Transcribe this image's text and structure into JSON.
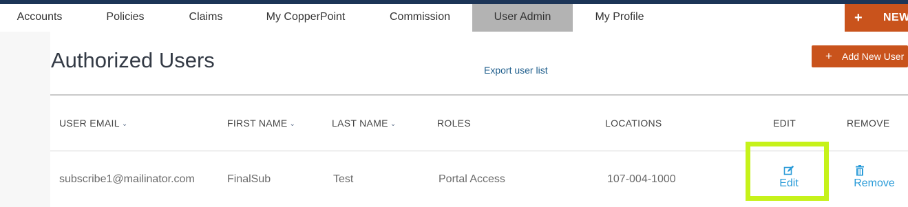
{
  "nav": {
    "items": [
      {
        "label": "Accounts"
      },
      {
        "label": "Policies"
      },
      {
        "label": "Claims"
      },
      {
        "label": "My CopperPoint"
      },
      {
        "label": "Commission"
      },
      {
        "label": "User Admin",
        "active": true
      },
      {
        "label": "My Profile"
      }
    ],
    "new_button": {
      "icon": "+",
      "label": "NEW"
    }
  },
  "page": {
    "title": "Authorized Users",
    "export_link": "Export user list",
    "add_button": {
      "icon": "+",
      "label": "Add New User"
    }
  },
  "table": {
    "columns": [
      "USER EMAIL",
      "FIRST NAME",
      "LAST NAME",
      "ROLES",
      "LOCATIONS",
      "EDIT",
      "REMOVE"
    ],
    "sort_icon": "chevron-down-icon",
    "rows": [
      {
        "email": "subscribe1@mailinator.com",
        "first_name": "FinalSub",
        "last_name": "Test",
        "roles": "Portal Access",
        "locations": "107-004-1000",
        "edit_label": "Edit",
        "remove_label": "Remove"
      }
    ]
  },
  "colors": {
    "brand_orange": "#c9531c",
    "nav_dark": "#1c3557",
    "link_blue": "#2a9bd8",
    "highlight": "#c6f21a"
  }
}
